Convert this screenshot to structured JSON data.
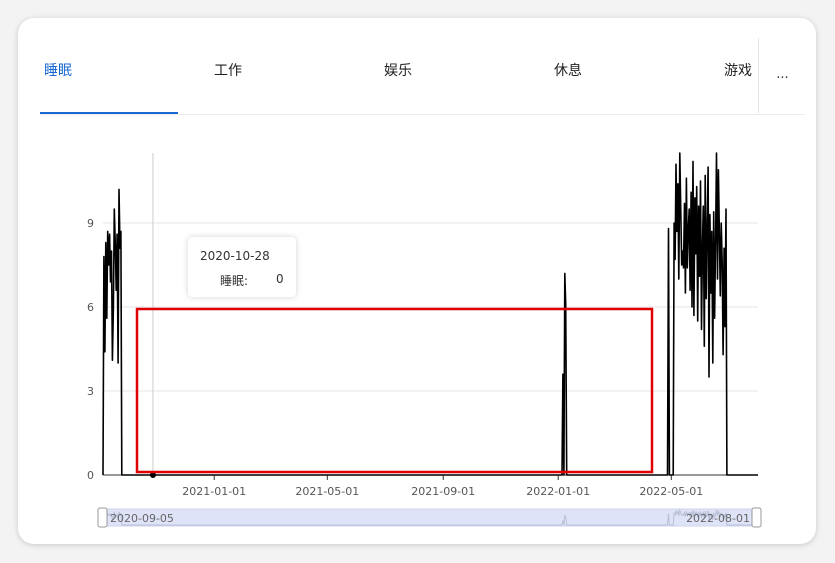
{
  "tabs": [
    {
      "label": "睡眠",
      "active": true
    },
    {
      "label": "工作",
      "active": false
    },
    {
      "label": "娱乐",
      "active": false
    },
    {
      "label": "休息",
      "active": false
    },
    {
      "label": "游戏",
      "active": false
    }
  ],
  "more_label": "...",
  "tooltip": {
    "date": "2020-10-28",
    "series": "睡眠:",
    "value": "0"
  },
  "zoom": {
    "start_label": "2020-09-05",
    "end_label": "2022-08-01"
  },
  "colors": {
    "accent": "#1967d2",
    "line": "#000000",
    "highlight": "#e00000",
    "slider": "#dfe3f7"
  },
  "chart_data": {
    "type": "line",
    "series": [
      {
        "name": "睡眠",
        "color": "#000000"
      }
    ],
    "x_range": [
      "2020-09-05",
      "2022-08-01"
    ],
    "ylim": [
      0,
      11.5
    ],
    "y_ticks": [
      0,
      3,
      6,
      9
    ],
    "x_ticks": [
      "2021-01-01",
      "2021-05-01",
      "2021-09-01",
      "2022-01-01",
      "2022-05-01"
    ],
    "grid": true,
    "legend": "none",
    "points": [
      [
        "2020-09-05",
        0.0
      ],
      [
        "2020-09-06",
        7.8
      ],
      [
        "2020-09-07",
        4.4
      ],
      [
        "2020-09-08",
        8.3
      ],
      [
        "2020-09-09",
        5.6
      ],
      [
        "2020-09-10",
        8.7
      ],
      [
        "2020-09-11",
        7.5
      ],
      [
        "2020-09-12",
        8.6
      ],
      [
        "2020-09-13",
        6.9
      ],
      [
        "2020-09-14",
        8.0
      ],
      [
        "2020-09-15",
        4.1
      ],
      [
        "2020-09-16",
        6.0
      ],
      [
        "2020-09-17",
        9.5
      ],
      [
        "2020-09-18",
        8.2
      ],
      [
        "2020-09-19",
        6.6
      ],
      [
        "2020-09-20",
        8.6
      ],
      [
        "2020-09-21",
        4.0
      ],
      [
        "2020-09-22",
        10.2
      ],
      [
        "2020-09-23",
        8.1
      ],
      [
        "2020-09-24",
        8.7
      ],
      [
        "2020-09-25",
        0.0
      ],
      [
        "2020-10-28",
        0.0
      ],
      [
        "2022-01-05",
        0.0
      ],
      [
        "2022-01-06",
        3.6
      ],
      [
        "2022-01-07",
        0.0
      ],
      [
        "2022-01-08",
        7.2
      ],
      [
        "2022-01-09",
        6.1
      ],
      [
        "2022-01-10",
        0.0
      ],
      [
        "2022-04-27",
        0.0
      ],
      [
        "2022-04-28",
        8.8
      ],
      [
        "2022-04-29",
        0.0
      ],
      [
        "2022-05-03",
        0.0
      ],
      [
        "2022-05-04",
        9.0
      ],
      [
        "2022-05-05",
        7.7
      ],
      [
        "2022-05-06",
        11.1
      ],
      [
        "2022-05-07",
        8.7
      ],
      [
        "2022-05-08",
        10.4
      ],
      [
        "2022-05-09",
        7.0
      ],
      [
        "2022-05-10",
        11.5
      ],
      [
        "2022-05-11",
        9.6
      ],
      [
        "2022-05-12",
        7.5
      ],
      [
        "2022-05-13",
        8.0
      ],
      [
        "2022-05-14",
        7.4
      ],
      [
        "2022-05-15",
        9.7
      ],
      [
        "2022-05-16",
        6.5
      ],
      [
        "2022-05-17",
        10.6
      ],
      [
        "2022-05-18",
        7.4
      ],
      [
        "2022-05-19",
        8.8
      ],
      [
        "2022-05-20",
        9.5
      ],
      [
        "2022-05-21",
        6.6
      ],
      [
        "2022-05-22",
        10.1
      ],
      [
        "2022-05-23",
        6.0
      ],
      [
        "2022-05-24",
        11.2
      ],
      [
        "2022-05-25",
        5.7
      ],
      [
        "2022-05-26",
        9.9
      ],
      [
        "2022-05-27",
        7.9
      ],
      [
        "2022-05-28",
        10.3
      ],
      [
        "2022-05-29",
        5.5
      ],
      [
        "2022-05-30",
        9.6
      ],
      [
        "2022-05-31",
        7.1
      ],
      [
        "2022-06-01",
        10.5
      ],
      [
        "2022-06-02",
        5.2
      ],
      [
        "2022-06-03",
        8.1
      ],
      [
        "2022-06-04",
        9.6
      ],
      [
        "2022-06-05",
        4.6
      ],
      [
        "2022-06-06",
        10.7
      ],
      [
        "2022-06-07",
        6.3
      ],
      [
        "2022-06-08",
        8.7
      ],
      [
        "2022-06-09",
        11.0
      ],
      [
        "2022-06-10",
        3.5
      ],
      [
        "2022-06-11",
        9.3
      ],
      [
        "2022-06-12",
        6.5
      ],
      [
        "2022-06-13",
        8.7
      ],
      [
        "2022-06-14",
        4.0
      ],
      [
        "2022-06-15",
        9.4
      ],
      [
        "2022-06-16",
        5.6
      ],
      [
        "2022-06-17",
        8.4
      ],
      [
        "2022-06-18",
        11.5
      ],
      [
        "2022-06-19",
        7.0
      ],
      [
        "2022-06-20",
        10.9
      ],
      [
        "2022-06-21",
        8.5
      ],
      [
        "2022-06-22",
        6.4
      ],
      [
        "2022-06-23",
        9.0
      ],
      [
        "2022-06-24",
        7.6
      ],
      [
        "2022-06-25",
        4.3
      ],
      [
        "2022-06-26",
        8.1
      ],
      [
        "2022-06-27",
        5.3
      ],
      [
        "2022-06-28",
        9.5
      ],
      [
        "2022-06-29",
        0.0
      ],
      [
        "2022-08-01",
        0.0
      ]
    ]
  }
}
